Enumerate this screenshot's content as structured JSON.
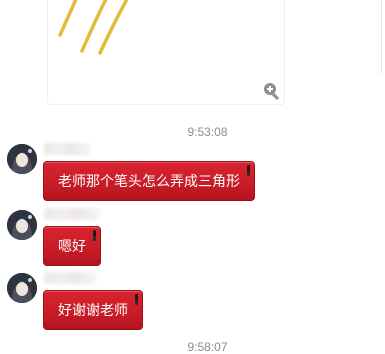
{
  "image_message": {
    "zoom_icon": "zoom-in-icon",
    "stroke_color": "#e2bb3c"
  },
  "bubble_color": "#c81d28",
  "messages": [
    {
      "timestamp": "9:53:08",
      "text": "老师那个笔头怎么弄成三角形"
    },
    {
      "timestamp": "",
      "text": "嗯好"
    },
    {
      "timestamp": "",
      "text": "好谢谢老师"
    }
  ],
  "footer_timestamp": "9:58:07"
}
